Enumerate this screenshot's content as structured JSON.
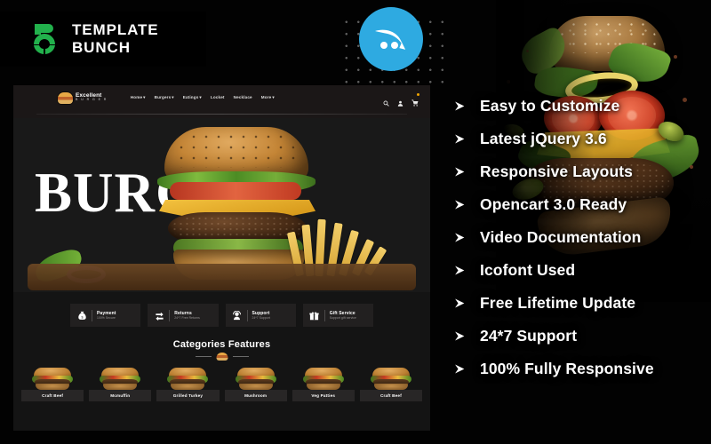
{
  "brand": {
    "logo_text": "TEMPLATE BUNCH",
    "logo_icon": "template-bunch-b-logo",
    "accent_green": "#22b14c"
  },
  "badge": {
    "icon": "opencart-logo-icon",
    "color": "#2eaae1"
  },
  "preview": {
    "site_logo": {
      "line1": "Excellent",
      "line2": "B U R G E R",
      "icon": "burger-logo-icon"
    },
    "nav_items": [
      {
        "label": "Home",
        "caret": "▾"
      },
      {
        "label": "Burgers",
        "caret": "▾"
      },
      {
        "label": "Eatings",
        "caret": "▾"
      },
      {
        "label": "Locket",
        "caret": ""
      },
      {
        "label": "Necklace",
        "caret": ""
      },
      {
        "label": "More",
        "caret": "▾"
      }
    ],
    "nav_icons": [
      "search-icon",
      "account-icon",
      "cart-icon"
    ],
    "hero_title": "BURGER",
    "services": [
      {
        "icon": "money-bag-icon",
        "title": "Payment",
        "subtitle": "100% Secure"
      },
      {
        "icon": "returns-arrows-icon",
        "title": "Returns",
        "subtitle": "24*7 Free Returns"
      },
      {
        "icon": "support-headset-icon",
        "title": "Support",
        "subtitle": "24*7 Support"
      },
      {
        "icon": "gift-box-icon",
        "title": "Gift Service",
        "subtitle": "Support gift service"
      }
    ],
    "categories_heading": "Categories Features",
    "category_cards": [
      {
        "label": "Craft Beef"
      },
      {
        "label": "Mcmuffin"
      },
      {
        "label": "Grilled Turkey"
      },
      {
        "label": "Mushroom"
      },
      {
        "label": "Veg Patties"
      },
      {
        "label": "Craft Beef"
      }
    ]
  },
  "features": {
    "bullet_icon": "arrow-right-triangle-icon",
    "items": [
      {
        "label": "Easy to Customize"
      },
      {
        "label": "Latest jQuery 3.6"
      },
      {
        "label": "Responsive Layouts"
      },
      {
        "label": "Opencart 3.0 Ready"
      },
      {
        "label": "Video Documentation"
      },
      {
        "label": "Icofont Used"
      },
      {
        "label": "Free Lifetime Update"
      },
      {
        "label": "24*7 Support"
      },
      {
        "label": "100% Fully Responsive"
      }
    ]
  }
}
